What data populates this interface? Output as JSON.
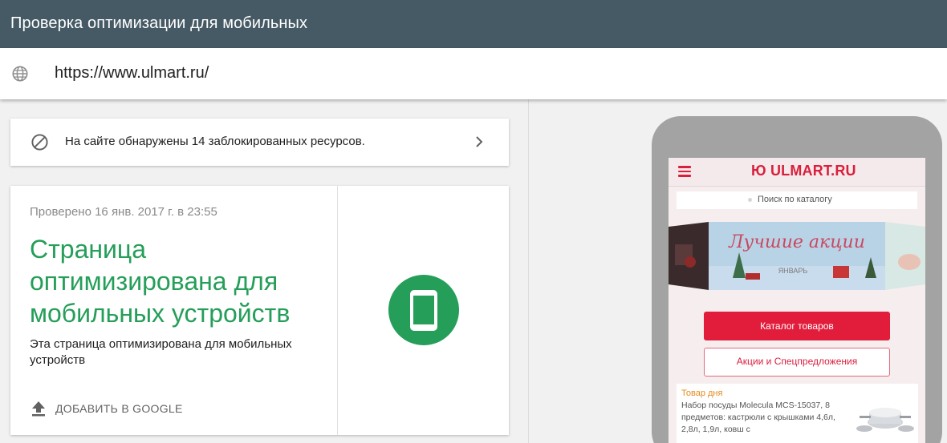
{
  "app": {
    "title": "Проверка оптимизации для мобильных"
  },
  "urlbar": {
    "url": "https://www.ulmart.ru/"
  },
  "blocked": {
    "message": "На сайте обнаружены 14 заблокированных ресурсов."
  },
  "result": {
    "checked": "Проверено 16 янв. 2017 г. в 23:55",
    "headline": "Страница оптимизирована для мобильных устройств",
    "description": "Эта страница оптимизирована для мобильных устройств",
    "add_button": "ДОБАВИТЬ В GOOGLE"
  },
  "preview": {
    "logo": "Ю ULMART.RU",
    "search_placeholder": "Поиск по каталогу",
    "banner_text": "Лучшие акции",
    "banner_sub": "ЯНВАРЬ",
    "catalog_button": "Каталог товаров",
    "promo_button": "Акции и Спецпредложения",
    "deal_title": "Товар дня",
    "deal_desc": "Набор посуды Molecula MCS-15037, 8 предметов: кастрюли с крышками 4,6л, 2,8л, 1,9л, ковш с"
  },
  "colors": {
    "topbar": "#455a64",
    "success": "#249e59",
    "brand": "#d91f3c"
  }
}
